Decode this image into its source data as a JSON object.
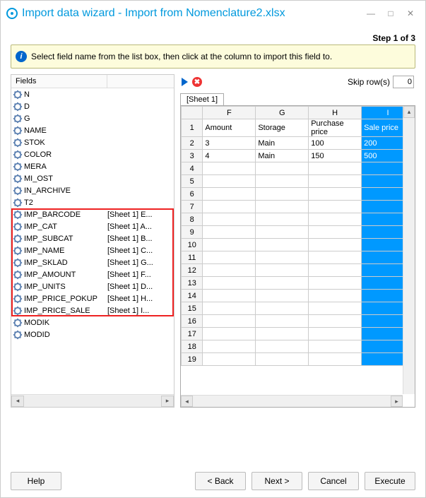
{
  "window": {
    "title": "Import data wizard - Import from Nomenclature2.xlsx"
  },
  "step": "Step 1 of 3",
  "info": "Select field name from the list box, then click at the column to import this field to.",
  "fields_header": [
    "Fields",
    ""
  ],
  "fields": [
    {
      "name": "N",
      "mapping": ""
    },
    {
      "name": "D",
      "mapping": ""
    },
    {
      "name": "G",
      "mapping": ""
    },
    {
      "name": "NAME",
      "mapping": ""
    },
    {
      "name": "STOK",
      "mapping": ""
    },
    {
      "name": "COLOR",
      "mapping": ""
    },
    {
      "name": "MERA",
      "mapping": ""
    },
    {
      "name": "MI_OST",
      "mapping": ""
    },
    {
      "name": "IN_ARCHIVE",
      "mapping": ""
    },
    {
      "name": "T2",
      "mapping": ""
    },
    {
      "name": "IMP_BARCODE",
      "mapping": "[Sheet 1] E..."
    },
    {
      "name": "IMP_CAT",
      "mapping": "[Sheet 1] A..."
    },
    {
      "name": "IMP_SUBCAT",
      "mapping": "[Sheet 1] B..."
    },
    {
      "name": "IMP_NAME",
      "mapping": "[Sheet 1] C..."
    },
    {
      "name": "IMP_SKLAD",
      "mapping": "[Sheet 1] G..."
    },
    {
      "name": "IMP_AMOUNT",
      "mapping": "[Sheet 1] F..."
    },
    {
      "name": "IMP_UNITS",
      "mapping": "[Sheet 1] D..."
    },
    {
      "name": "IMP_PRICE_POKUP",
      "mapping": "[Sheet 1] H..."
    },
    {
      "name": "IMP_PRICE_SALE",
      "mapping": "[Sheet 1] I..."
    },
    {
      "name": "MODIK",
      "mapping": ""
    },
    {
      "name": "MODID",
      "mapping": ""
    }
  ],
  "highlight": {
    "start": 10,
    "end": 18
  },
  "skip_label": "Skip row(s)",
  "skip_value": "0",
  "sheet_tab": "[Sheet 1]",
  "columns": [
    "F",
    "G",
    "H",
    "I"
  ],
  "selected_col": 3,
  "rows": [
    [
      "Amount",
      "Storage",
      "Purchase price",
      "Sale price"
    ],
    [
      "3",
      "Main",
      "100",
      "200"
    ],
    [
      "4",
      "Main",
      "150",
      "500"
    ],
    [
      "",
      "",
      "",
      ""
    ],
    [
      "",
      "",
      "",
      ""
    ],
    [
      "",
      "",
      "",
      ""
    ],
    [
      "",
      "",
      "",
      ""
    ],
    [
      "",
      "",
      "",
      ""
    ],
    [
      "",
      "",
      "",
      ""
    ],
    [
      "",
      "",
      "",
      ""
    ],
    [
      "",
      "",
      "",
      ""
    ],
    [
      "",
      "",
      "",
      ""
    ],
    [
      "",
      "",
      "",
      ""
    ],
    [
      "",
      "",
      "",
      ""
    ],
    [
      "",
      "",
      "",
      ""
    ],
    [
      "",
      "",
      "",
      ""
    ],
    [
      "",
      "",
      "",
      ""
    ],
    [
      "",
      "",
      "",
      ""
    ],
    [
      "",
      "",
      "",
      ""
    ]
  ],
  "buttons": {
    "help": "Help",
    "back": "< Back",
    "next": "Next >",
    "cancel": "Cancel",
    "execute": "Execute"
  }
}
